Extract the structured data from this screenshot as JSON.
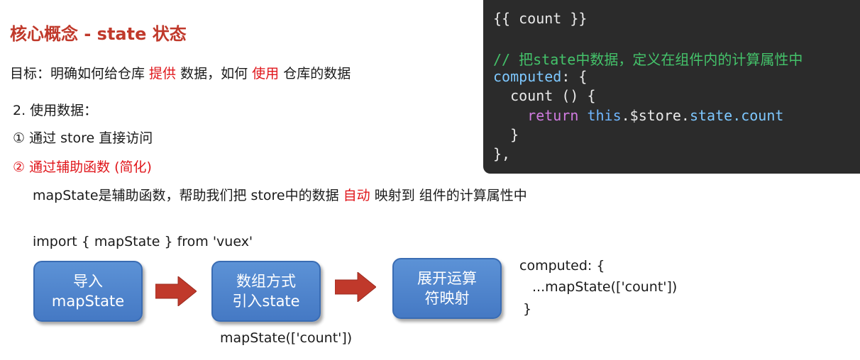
{
  "title": "核心概念 - state 状态",
  "goal": {
    "prefix": "目标：明确如何给仓库 ",
    "highlight1": "提供",
    "middle": " 数据，如何 ",
    "highlight2": "使用",
    "suffix": " 仓库的数据"
  },
  "section": "2. 使用数据：",
  "option1": "① 通过 store 直接访问",
  "option2": "② 通过辅助函数 (简化)",
  "desc": {
    "prefix": "mapState是辅助函数，帮助我们把 store中的数据 ",
    "highlight": "自动",
    "suffix": " 映射到 组件的计算属性中"
  },
  "import_line": "import { mapState } from 'vuex'",
  "flow": {
    "steps": [
      {
        "line1": "导入",
        "line2": "mapState"
      },
      {
        "line1": "数组方式",
        "line2": "引入state"
      },
      {
        "line1": "展开运算",
        "line2": "符映射"
      }
    ],
    "step2_caption": "mapState(['count'])"
  },
  "computed_snippet": {
    "line1": "computed: {",
    "line2": "...mapState(['count'])",
    "line3": "}"
  },
  "code": {
    "line1": "{{ count }}",
    "comment": "// 把state中数据，定义在组件内的计算属性中",
    "computed_kw": "computed",
    "computed_rest": ": {",
    "count_kw": "count",
    "count_rest": " () {",
    "return_kw": "return",
    "this_kw": "this",
    "dollar_store": ".$store.",
    "state_kw": "state",
    "count_prop": ".count",
    "close_brace": "}",
    "close_obj": "},"
  },
  "colors": {
    "title": "#c0392b",
    "highlight": "#e0161b",
    "box_fill": "#4f86cf",
    "arrow": "#c0392b",
    "code_bg": "#2b2b2b",
    "comment": "#44c26a"
  }
}
